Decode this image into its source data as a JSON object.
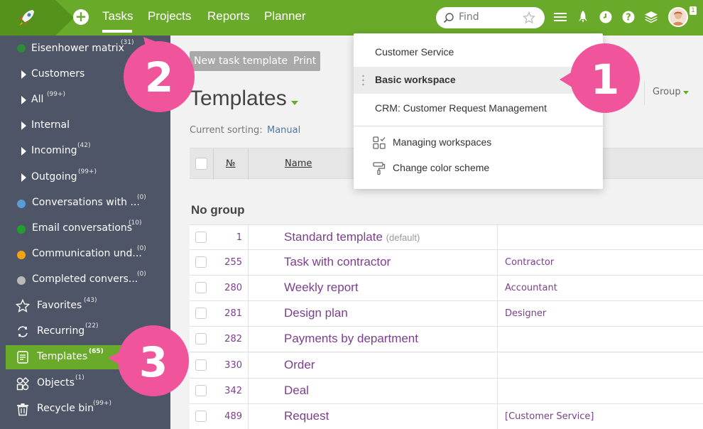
{
  "topbar": {
    "nav": [
      "Tasks",
      "Projects",
      "Reports",
      "Planner"
    ],
    "active_nav": "Tasks",
    "search_placeholder": "Find",
    "avatar_badge": "1",
    "icons": [
      "rocket-logo-icon",
      "plus-icon",
      "search-icon",
      "star-icon",
      "menu-icon",
      "rocket-icon",
      "clock-icon",
      "help-icon",
      "layers-icon"
    ]
  },
  "sidebar": {
    "items": [
      {
        "label": "Eisenhower matrix",
        "count": "(31)",
        "marker": "dot",
        "color": "#2e8b3a"
      },
      {
        "label": "Customers",
        "count": "",
        "marker": "arrow"
      },
      {
        "label": "All",
        "count": "(99+)",
        "marker": "arrow"
      },
      {
        "label": "Internal",
        "count": "",
        "marker": "arrow"
      },
      {
        "label": "Incoming",
        "count": "(42)",
        "marker": "arrow"
      },
      {
        "label": "Outgoing",
        "count": "(99+)",
        "marker": "arrow"
      },
      {
        "label": "Conversations with ...",
        "count": "(0)",
        "marker": "dot",
        "color": "#5b9bd5"
      },
      {
        "label": "Email conversations",
        "count": "(10)",
        "marker": "dot",
        "color": "#22a02e"
      },
      {
        "label": "Communication und...",
        "count": "(0)",
        "marker": "dot",
        "color": "#f5a30f"
      },
      {
        "label": "Completed convers...",
        "count": "(0)",
        "marker": "dot",
        "color": "#b9b9b9"
      },
      {
        "label": "Favorites",
        "count": "(43)",
        "marker": "icon",
        "icon": "star-icon"
      },
      {
        "label": "Recurring",
        "count": "(22)",
        "marker": "icon",
        "icon": "recurring-icon"
      },
      {
        "label": "Templates",
        "count": "(65)",
        "marker": "icon",
        "icon": "templates-icon",
        "active": true
      },
      {
        "label": "Objects",
        "count": "(1)",
        "marker": "icon",
        "icon": "objects-icon"
      },
      {
        "label": "Recycle bin",
        "count": "(99+)",
        "marker": "icon",
        "icon": "trash-icon"
      }
    ]
  },
  "main": {
    "buttons": [
      "New task template",
      "Print"
    ],
    "title": "Templates",
    "sorting_label": "Current sorting:",
    "sorting_value": "Manual",
    "group_label": "Group",
    "columns": [
      "№",
      "Name"
    ],
    "group_title": "No group",
    "rows": [
      {
        "num": "1",
        "name": "Standard template",
        "default": "(default)",
        "role": ""
      },
      {
        "num": "255",
        "name": "Task with contractor",
        "default": "",
        "role": "Contractor"
      },
      {
        "num": "280",
        "name": "Weekly report",
        "default": "",
        "role": "Accountant"
      },
      {
        "num": "281",
        "name": "Design plan",
        "default": "",
        "role": "Designer"
      },
      {
        "num": "282",
        "name": "Payments by department",
        "default": "",
        "role": ""
      },
      {
        "num": "330",
        "name": "Order",
        "default": "",
        "role": ""
      },
      {
        "num": "342",
        "name": "Deal",
        "default": "",
        "role": ""
      },
      {
        "num": "489",
        "name": "Request",
        "default": "",
        "role": "[Customer Service]"
      }
    ]
  },
  "dropdown": {
    "workspaces": [
      "Customer Service",
      "Basic workspace",
      "CRM: Customer Request Management"
    ],
    "selected": "Basic workspace",
    "actions": [
      "Managing workspaces",
      "Change color scheme"
    ]
  },
  "callouts": [
    "1",
    "2",
    "3"
  ],
  "colors": {
    "green": "#6aaa2a",
    "sidebar": "#4e5566",
    "pink": "#f0559b",
    "purple_text": "#7b3f8c"
  }
}
